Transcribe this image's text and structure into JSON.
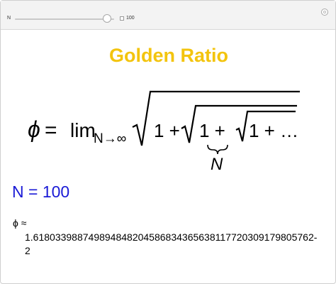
{
  "controls": {
    "slider_label": "N",
    "slider_value": "100",
    "slider_fraction": 0.93
  },
  "title": "Golden Ratio",
  "formula": {
    "phi": "ϕ",
    "equals": "=",
    "lim": "lim",
    "lim_subscript": "N→∞",
    "one_plus_1": "1 +",
    "one_plus_2": "1 +",
    "one_plus_3": "1 + …",
    "brace_label": "N"
  },
  "n_display": "N = 100",
  "result": {
    "approx_label": "ϕ ≈",
    "digits_line1": "1.618033988749894848204586834365638117720309179805762-",
    "digits_line2": "2"
  },
  "colors": {
    "title": "#f3c40e",
    "n_display": "#1a1ad6"
  }
}
